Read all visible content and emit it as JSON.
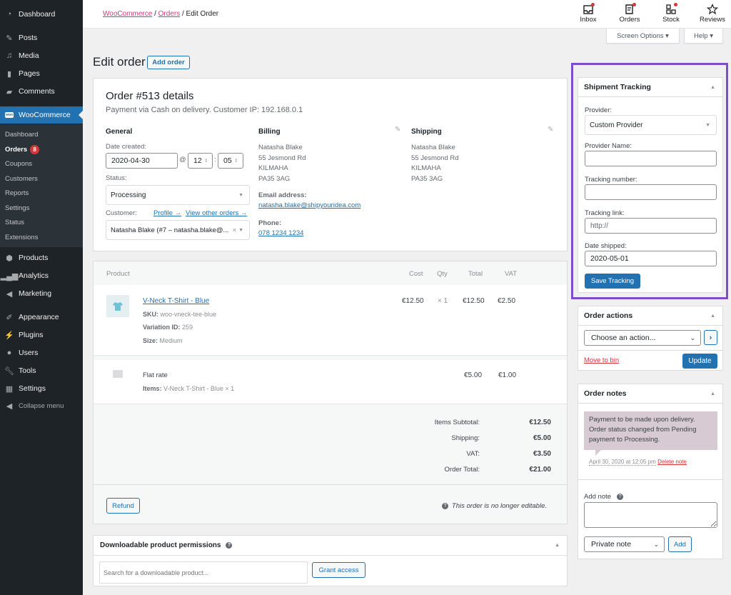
{
  "sidebar": {
    "top_items": [
      {
        "label": "Dashboard",
        "icon": "dashboard-icon"
      },
      {
        "label": "Posts",
        "icon": "pin-icon"
      },
      {
        "label": "Media",
        "icon": "media-icon"
      },
      {
        "label": "Pages",
        "icon": "pages-icon"
      },
      {
        "label": "Comments",
        "icon": "comment-icon"
      },
      {
        "label": "WooCommerce",
        "icon": "woo-icon"
      }
    ],
    "submenu": [
      {
        "label": "Dashboard"
      },
      {
        "label": "Orders",
        "badge": "8"
      },
      {
        "label": "Coupons"
      },
      {
        "label": "Customers"
      },
      {
        "label": "Reports"
      },
      {
        "label": "Settings"
      },
      {
        "label": "Status"
      },
      {
        "label": "Extensions"
      }
    ],
    "bottom_items": [
      {
        "label": "Products",
        "icon": "box-icon"
      },
      {
        "label": "Analytics",
        "icon": "bar-chart-icon"
      },
      {
        "label": "Marketing",
        "icon": "megaphone-icon"
      },
      {
        "label": "Appearance",
        "icon": "brush-icon"
      },
      {
        "label": "Plugins",
        "icon": "plug-icon"
      },
      {
        "label": "Users",
        "icon": "user-icon"
      },
      {
        "label": "Tools",
        "icon": "wrench-icon"
      },
      {
        "label": "Settings",
        "icon": "settings-icon"
      },
      {
        "label": "Collapse menu",
        "icon": "collapse-icon"
      }
    ]
  },
  "header": {
    "breadcrumb": {
      "root": "WooCommerce",
      "parent": "Orders",
      "current": "Edit Order",
      "sep": "/"
    },
    "activity": [
      {
        "label": "Inbox",
        "icon": "inbox-icon",
        "dot": true
      },
      {
        "label": "Orders",
        "icon": "orders-icon",
        "dot": true
      },
      {
        "label": "Stock",
        "icon": "stock-icon",
        "dot": true
      },
      {
        "label": "Reviews",
        "icon": "star-icon",
        "dot": false
      }
    ],
    "screen_options": "Screen Options ▾",
    "help": "Help ▾"
  },
  "page": {
    "title": "Edit order",
    "add_order": "Add order"
  },
  "order": {
    "title": "Order #513 details",
    "subtitle": "Payment via Cash on delivery. Customer IP: 192.168.0.1",
    "general": {
      "heading": "General",
      "date_label": "Date created:",
      "date": "2020-04-30",
      "at": "@",
      "hour": "12",
      "colon": ":",
      "minute": "05",
      "status_label": "Status:",
      "status": "Processing",
      "customer_label": "Customer:",
      "profile_link": "Profile →",
      "other_orders_link": "View other orders →",
      "customer": "Natasha Blake (#7 – natasha.blake@...",
      "clear": "×"
    },
    "billing": {
      "heading": "Billing",
      "lines": [
        "Natasha Blake",
        "55 Jesmond Rd",
        "KILMAHA",
        "PA35 3AG"
      ],
      "email_label": "Email address:",
      "email": "natasha.blake@shipyouridea.com",
      "phone_label": "Phone:",
      "phone": "078 1234 1234"
    },
    "shipping": {
      "heading": "Shipping",
      "lines": [
        "Natasha Blake",
        "55 Jesmond Rd",
        "KILMAHA",
        "PA35 3AG"
      ]
    }
  },
  "items": {
    "columns": [
      "Product",
      "Cost",
      "Qty",
      "Total",
      "VAT"
    ],
    "rows": [
      {
        "name": "V-Neck T-Shirt - Blue",
        "sku_label": "SKU:",
        "sku": "woo-vneck-tee-blue",
        "variation_label": "Variation ID:",
        "variation": "259",
        "size_label": "Size:",
        "size": "Medium",
        "cost": "€12.50",
        "qty": "× 1",
        "total": "€12.50",
        "vat": "€2.50"
      }
    ],
    "shipping": {
      "name": "Flat rate",
      "items_label": "Items:",
      "items": "V-Neck T-Shirt - Blue × 1",
      "total": "€5.00",
      "vat": "€1.00"
    },
    "totals": [
      {
        "label": "Items Subtotal:",
        "value": "€12.50"
      },
      {
        "label": "Shipping:",
        "value": "€5.00"
      },
      {
        "label": "VAT:",
        "value": "€3.50"
      },
      {
        "label": "Order Total:",
        "value": "€21.00"
      }
    ],
    "refund": "Refund",
    "not_editable": "This order is no longer editable."
  },
  "downloads": {
    "title": "Downloadable product permissions",
    "search_placeholder": "Search for a downloadable product...",
    "grant": "Grant access"
  },
  "tracking": {
    "title": "Shipment Tracking",
    "provider_label": "Provider:",
    "provider": "Custom Provider",
    "provider_name_label": "Provider Name:",
    "provider_name": "",
    "tracking_number_label": "Tracking number:",
    "tracking_number": "",
    "tracking_link_label": "Tracking link:",
    "tracking_link_placeholder": "http://",
    "date_shipped_label": "Date shipped:",
    "date_shipped": "2020-05-01",
    "save": "Save Tracking",
    "highlight_color": "#7e4fc4"
  },
  "actions": {
    "title": "Order actions",
    "select": "Choose an action...",
    "go": "›",
    "bin": "Move to bin",
    "update": "Update"
  },
  "notes": {
    "title": "Order notes",
    "note_text": "Payment to be made upon delivery. Order status changed from Pending payment to Processing.",
    "note_date": "April 30, 2020 at 12:05 pm",
    "delete": "Delete note",
    "add_label": "Add note",
    "type": "Private note",
    "add": "Add"
  }
}
